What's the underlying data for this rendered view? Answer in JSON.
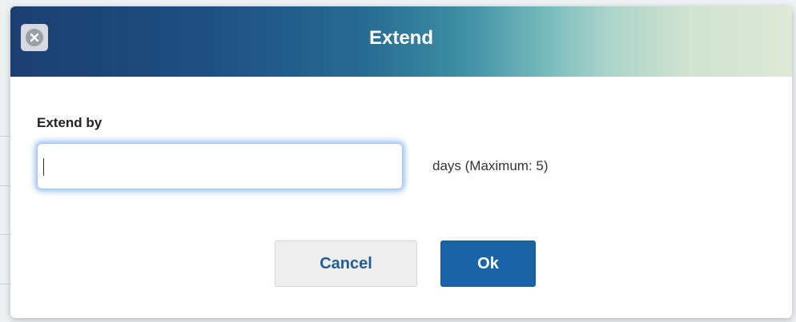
{
  "dialog": {
    "title": "Extend",
    "close_icon": "close-circle-icon"
  },
  "form": {
    "label": "Extend by",
    "input_value": "",
    "hint": "days (Maximum: 5)"
  },
  "buttons": {
    "cancel_label": "Cancel",
    "ok_label": "Ok"
  },
  "colors": {
    "primary": "#1a63a6",
    "title_gradient_start": "#1b3f70",
    "title_gradient_end": "#dfe9d8",
    "focus_glow": "#70a8e8"
  }
}
